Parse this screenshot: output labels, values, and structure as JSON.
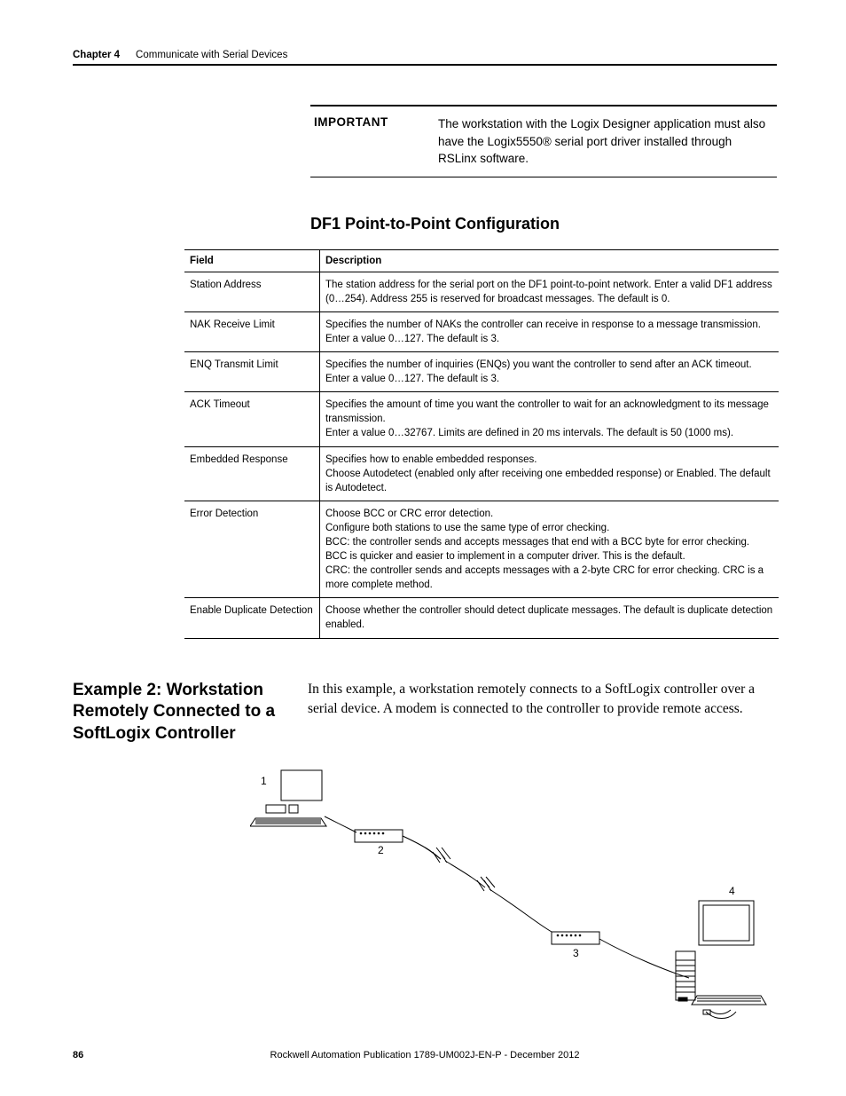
{
  "header": {
    "chapter": "Chapter 4",
    "title": "Communicate with Serial Devices"
  },
  "important": {
    "label": "IMPORTANT",
    "text": "The workstation with the Logix Designer application must also have the Logix5550® serial port driver installed through RSLinx software."
  },
  "section_heading": "DF1 Point-to-Point Configuration",
  "table": {
    "headers": [
      "Field",
      "Description"
    ],
    "rows": [
      {
        "field": "Station Address",
        "desc": "The station address for the serial port on the DF1 point-to-point network. Enter a valid DF1 address (0…254). Address 255 is reserved for broadcast messages. The default is 0."
      },
      {
        "field": "NAK Receive Limit",
        "desc": "Specifies the number of NAKs the controller can receive in response to a message transmission.\nEnter a value 0…127. The default is 3."
      },
      {
        "field": "ENQ Transmit Limit",
        "desc": "Specifies the number of inquiries (ENQs) you want the controller to send after an ACK timeout.\nEnter a value 0…127. The default is 3."
      },
      {
        "field": "ACK Timeout",
        "desc": "Specifies the amount of time you want the controller to wait for an acknowledgment to its message transmission.\nEnter a value 0…32767. Limits are defined in 20 ms intervals. The default is 50 (1000 ms)."
      },
      {
        "field": "Embedded Response",
        "desc": "Specifies how to enable embedded responses.\nChoose Autodetect (enabled only after receiving one embedded response) or Enabled. The default is Autodetect."
      },
      {
        "field": "Error Detection",
        "desc": "Choose BCC or CRC error detection.\nConfigure both stations to use the same type of error checking.\nBCC: the controller sends and accepts messages that end with a BCC byte for error checking. BCC is quicker and easier to implement in a computer driver. This is the default.\nCRC: the controller sends and accepts messages with a 2-byte CRC for error checking. CRC is a more complete method."
      },
      {
        "field": "Enable Duplicate Detection",
        "desc": "Choose whether the controller should detect duplicate messages. The default is duplicate detection enabled."
      }
    ]
  },
  "example": {
    "heading": "Example 2: Workstation Remotely Connected to a SoftLogix Controller",
    "body": "In this example, a workstation remotely connects to a SoftLogix controller over a serial device. A modem is connected to the controller to provide remote access."
  },
  "diagram_labels": {
    "l1": "1",
    "l2": "2",
    "l3": "3",
    "l4": "4"
  },
  "footer": {
    "page": "86",
    "pub": "Rockwell Automation Publication 1789-UM002J-EN-P - December 2012"
  }
}
